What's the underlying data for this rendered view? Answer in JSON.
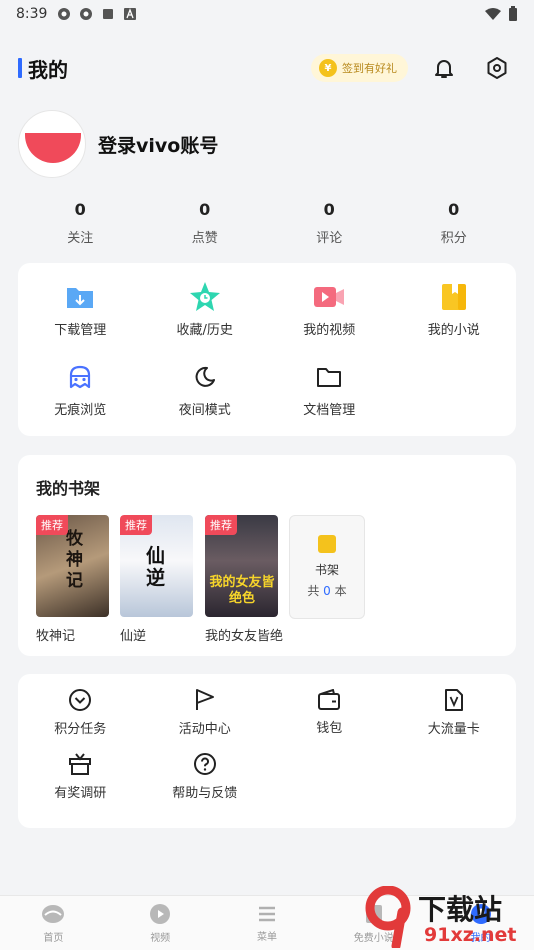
{
  "status": {
    "time": "8:39"
  },
  "header": {
    "title": "我的",
    "signin": "签到有好礼"
  },
  "profile": {
    "login": "登录vivo账号"
  },
  "stats": [
    {
      "value": "0",
      "label": "关注"
    },
    {
      "value": "0",
      "label": "点赞"
    },
    {
      "value": "0",
      "label": "评论"
    },
    {
      "value": "0",
      "label": "积分"
    }
  ],
  "tools": [
    {
      "label": "下载管理",
      "icon": "download-folder-icon"
    },
    {
      "label": "收藏/历史",
      "icon": "star-clock-icon"
    },
    {
      "label": "我的视频",
      "icon": "video-icon"
    },
    {
      "label": "我的小说",
      "icon": "book-icon"
    },
    {
      "label": "无痕浏览",
      "icon": "incognito-icon"
    },
    {
      "label": "夜间模式",
      "icon": "moon-icon"
    },
    {
      "label": "文档管理",
      "icon": "folder-icon"
    }
  ],
  "shelf": {
    "title": "我的书架",
    "tag": "推荐",
    "books": [
      {
        "title": "牧神记",
        "cover_text": "牧神记"
      },
      {
        "title": "仙逆",
        "cover_text": "仙逆"
      },
      {
        "title": "我的女友皆绝",
        "cover_text": "我的女友皆绝色"
      }
    ],
    "box_label": "书架",
    "count_prefix": "共",
    "count": "0",
    "count_suffix": "本"
  },
  "services": [
    {
      "label": "积分任务",
      "icon": "chevron-circle-icon"
    },
    {
      "label": "活动中心",
      "icon": "flag-icon"
    },
    {
      "label": "钱包",
      "icon": "wallet-icon"
    },
    {
      "label": "大流量卡",
      "icon": "sim-card-icon"
    },
    {
      "label": "有奖调研",
      "icon": "gift-icon"
    },
    {
      "label": "帮助与反馈",
      "icon": "help-icon"
    }
  ],
  "tabbar": [
    {
      "label": "首页"
    },
    {
      "label": "视频"
    },
    {
      "label": "菜单"
    },
    {
      "label": "免费小说"
    },
    {
      "label": "我的"
    }
  ],
  "watermark": {
    "brand": "下载站",
    "domain": "91xz.net"
  },
  "colors": {
    "accent": "#2f6bff",
    "tag": "#f04a5a",
    "coin": "#f4c21c"
  }
}
